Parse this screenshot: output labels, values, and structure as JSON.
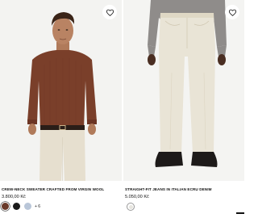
{
  "products": [
    {
      "name": "CREW-NECK SWEATER CRAFTED FROM VIRGIN WOOL",
      "price": "3.800,00 Kč",
      "swatches": [
        {
          "color": "#6a3a2a",
          "selected": true
        },
        {
          "color": "#1b1b1b",
          "selected": false
        },
        {
          "color": "#b9c6d8",
          "selected": false
        }
      ],
      "more_colors": "+ 6",
      "favorite_icon": "heart-outline-icon"
    },
    {
      "name": "STRAIGHT-FIT JEANS IN ITALIAN ECRU DENIM",
      "price": "5.050,00 Kč",
      "swatches": [
        {
          "color": "#e7e5df",
          "selected": true
        }
      ],
      "favorite_icon": "heart-outline-icon"
    }
  ],
  "colors": {
    "background": "#ffffff",
    "photo_bg": "#f3f3f1",
    "sweater": "#7a3f2a",
    "trousers": "#e6dfcf",
    "jeans": "#e9e4d6",
    "shirt_grey": "#8f8c8a",
    "text": "#111111"
  }
}
